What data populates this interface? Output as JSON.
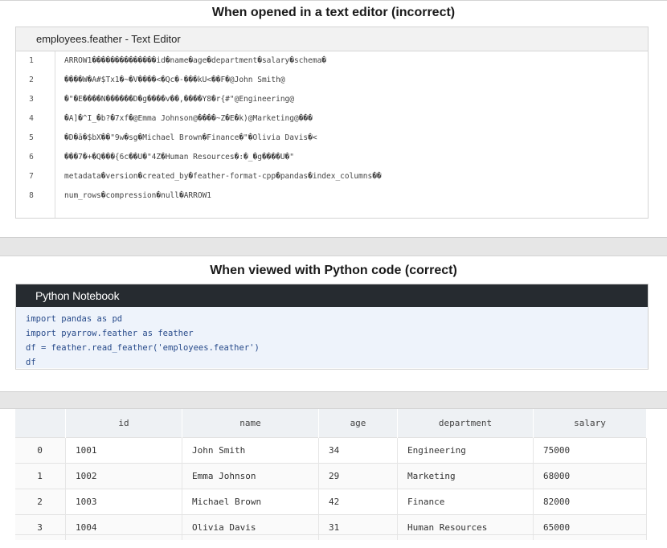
{
  "section1": {
    "title": "When opened in a text editor (incorrect)",
    "editor_title": "employees.feather - Text Editor",
    "lines": [
      {
        "n": "1",
        "text": "ARROW1��������������id�name�age�department�salary�schema�"
      },
      {
        "n": "2",
        "text": "����W�A#$Tx1�~�V����<�Qc�-���kU<��F�@John Smith@"
      },
      {
        "n": "3",
        "text": "�\"�E����N������D�g����v��,����Y8�r{#\"@Engineering@"
      },
      {
        "n": "4",
        "text": "�A]�^I_�b?�7xf�@Emma Johnson@����~Z�E�k)@Marketing@���"
      },
      {
        "n": "5",
        "text": "�D�ā�$bX��\"9w�sg�Michael Brown�Finance�\"�Olivia Davis�<"
      },
      {
        "n": "6",
        "text": "���7�+�Q���{6c��U�\"4Z�Human Resources�:�_�g����U�\""
      },
      {
        "n": "7",
        "text": "metadata�version�created_by�feather-format-cpp�pandas�index_columns��"
      },
      {
        "n": "8",
        "text": "num_rows�compression�null�ARROW1"
      }
    ]
  },
  "section2": {
    "title": "When viewed with Python code (correct)",
    "notebook_title": "Python Notebook",
    "code": [
      "import pandas as pd",
      "import pyarrow.feather as feather",
      "df = feather.read_feather('employees.feather')",
      "df"
    ]
  },
  "section3": {
    "columns": [
      "",
      "id",
      "name",
      "age",
      "department",
      "salary"
    ],
    "rows": [
      [
        "0",
        "1001",
        "John Smith",
        "34",
        "Engineering",
        "75000"
      ],
      [
        "1",
        "1002",
        "Emma Johnson",
        "29",
        "Marketing",
        "68000"
      ],
      [
        "2",
        "1003",
        "Michael Brown",
        "42",
        "Finance",
        "82000"
      ],
      [
        "3",
        "1004",
        "Olivia Davis",
        "31",
        "Human Resources",
        "65000"
      ]
    ]
  }
}
